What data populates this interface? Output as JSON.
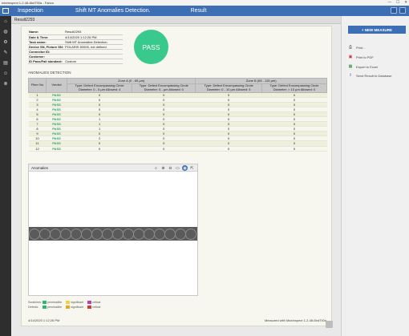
{
  "window": {
    "title": "Interinspect 1-2-48-6bd700a - Fabco",
    "controls": [
      "—",
      "☐",
      "✕"
    ]
  },
  "topbar": {
    "section": "Inspection",
    "title": "Shift MT Anomalies Detection.",
    "result": "Result"
  },
  "sidebar": {
    "icons": [
      "home-icon",
      "globe-icon",
      "gear-icon",
      "tools-icon",
      "folder-icon",
      "users-icon",
      "close-circle-icon"
    ]
  },
  "header": {
    "title": "Result2293"
  },
  "info": {
    "rows": [
      {
        "label": "Name:",
        "value": "Result2293"
      },
      {
        "label": "Date & Time:",
        "value": "4/14/2020 1:12:26 PM"
      },
      {
        "label": "Task name:",
        "value": "Shift MT Anomalies Detection."
      },
      {
        "label": "Device SN, Fixture SN:",
        "value": "POLARIS 60005, not defined"
      },
      {
        "label": "Connector ID:",
        "value": ""
      },
      {
        "label": "Customer:",
        "value": ""
      },
      {
        "label": "ID Pass/Fail standard:",
        "value": "Custom"
      }
    ]
  },
  "verdict": {
    "label": "PASS",
    "color": "#3ac98c"
  },
  "anomalies": {
    "title": "ANOMALIES DETECTION",
    "headers": {
      "fiber": "Fiber No",
      "verdict": "Verdict",
      "zone_a": "Zone A (0 - 65 µm)",
      "zone_b": "Zone B (65 - 115 µm)",
      "col_a1": "Type: Defect Encompassing Circle Diameter: 0 - 5 µm Allowed: 4",
      "col_a2": "Type: Defect Encompassing Circle Diameter: 5 - µm Allowed: 0",
      "col_b1": "Type: Defect Encompassing Circle Diameter: 0 - 10 µm Allowed: 5",
      "col_b2": "Type: Defect Encompassing Circle Diameter: > 10 µm Allowed: 0"
    },
    "rows": [
      {
        "fiber": "1",
        "verdict": "PASS",
        "a1": "0",
        "a2": "0",
        "b1": "0",
        "b2": "0"
      },
      {
        "fiber": "2",
        "verdict": "PASS",
        "a1": "0",
        "a2": "0",
        "b1": "0",
        "b2": "0"
      },
      {
        "fiber": "3",
        "verdict": "PASS",
        "a1": "0",
        "a2": "0",
        "b1": "0",
        "b2": "0"
      },
      {
        "fiber": "4",
        "verdict": "PASS",
        "a1": "0",
        "a2": "0",
        "b1": "0",
        "b2": "0"
      },
      {
        "fiber": "5",
        "verdict": "PASS",
        "a1": "0",
        "a2": "0",
        "b1": "0",
        "b2": "0"
      },
      {
        "fiber": "6",
        "verdict": "PASS",
        "a1": "1",
        "a2": "0",
        "b1": "0",
        "b2": "0"
      },
      {
        "fiber": "7",
        "verdict": "PASS",
        "a1": "1",
        "a2": "0",
        "b1": "0",
        "b2": "0"
      },
      {
        "fiber": "8",
        "verdict": "PASS",
        "a1": "1",
        "a2": "0",
        "b1": "0",
        "b2": "0"
      },
      {
        "fiber": "9",
        "verdict": "PASS",
        "a1": "0",
        "a2": "0",
        "b1": "0",
        "b2": "0"
      },
      {
        "fiber": "10",
        "verdict": "PASS",
        "a1": "2",
        "a2": "0",
        "b1": "0",
        "b2": "0"
      },
      {
        "fiber": "11",
        "verdict": "PASS",
        "a1": "0",
        "a2": "0",
        "b1": "0",
        "b2": "0"
      },
      {
        "fiber": "12",
        "verdict": "PASS",
        "a1": "0",
        "a2": "0",
        "b1": "0",
        "b2": "0"
      }
    ]
  },
  "viewer": {
    "title": "Anomalies",
    "tools": [
      "zoom-fit-icon",
      "zoom-in-icon",
      "zoom-out-icon",
      "ruler-icon",
      "zoom-active-icon",
      "external-link-icon"
    ],
    "fiber_count": 16
  },
  "legend": {
    "scratches_label": "Scratches:",
    "defects_label": "Defects:",
    "items": [
      {
        "label": "permissible",
        "color": "#2bb673"
      },
      {
        "label": "significant",
        "color": "#f0d33a"
      },
      {
        "label": "critical",
        "color": "#c23bb0"
      }
    ],
    "defect_items": [
      {
        "label": "permissible",
        "color": "#2bb673"
      },
      {
        "label": "significant",
        "color": "#f0a51f"
      },
      {
        "label": "critical",
        "color": "#d63a2a"
      }
    ]
  },
  "footer": {
    "datetime": "4/14/2020 1:12:26 PM",
    "measured": "Measured with MaxInspect 1-2-48-6bd700a"
  },
  "actions": {
    "new_measure": "+ NEW MEASURE",
    "print": "Print...",
    "print_pdf": "Print to PDF",
    "export_excel": "Export to Excel",
    "send_db": "Send Result to Database"
  }
}
